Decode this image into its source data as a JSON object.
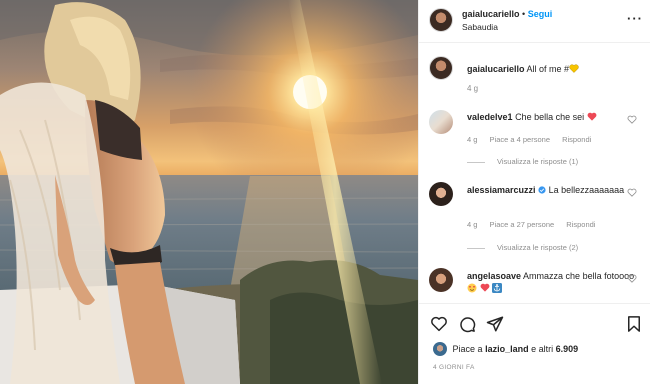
{
  "post": {
    "username": "gaialucariello",
    "follow_label": "Segui",
    "location": "Sabaudia",
    "caption_text": "All of me #",
    "caption_emoji": "yellow-heart-icon",
    "caption_time": "4 g",
    "more_icon": "more-options-icon"
  },
  "comments": [
    {
      "user": "valedelve1",
      "text": "Che bella che sei",
      "emoji": "red-heart-icon",
      "time": "4 g",
      "likes": "Piace a 4 persone",
      "reply": "Rispondi",
      "view_replies": "Visualizza le risposte (1)"
    },
    {
      "user": "alessiamarcuzzi",
      "verified": "verified-badge-icon",
      "text": "La bellezzaaaaaaa",
      "time": "4 g",
      "likes": "Piace a 27 persone",
      "reply": "Rispondi",
      "view_replies": "Visualizza le risposte (2)"
    },
    {
      "user": "angelasoave",
      "text": "Ammazza che bella fotoooo",
      "emojis": [
        "heart-eyes-icon",
        "red-heart-icon",
        "anchor-icon"
      ]
    }
  ],
  "footer": {
    "liked_by_prefix": "Piace a",
    "liked_by_user": "lazio_land",
    "liked_by_suffix": "e altri",
    "likes_count": "6.909",
    "posted_ago": "4 GIORNI FA"
  },
  "colors": {
    "follow_blue": "#0095f6",
    "meta_gray": "#8e8e8e",
    "heart_red": "#ed4956",
    "heart_yellow": "#f7c400"
  }
}
